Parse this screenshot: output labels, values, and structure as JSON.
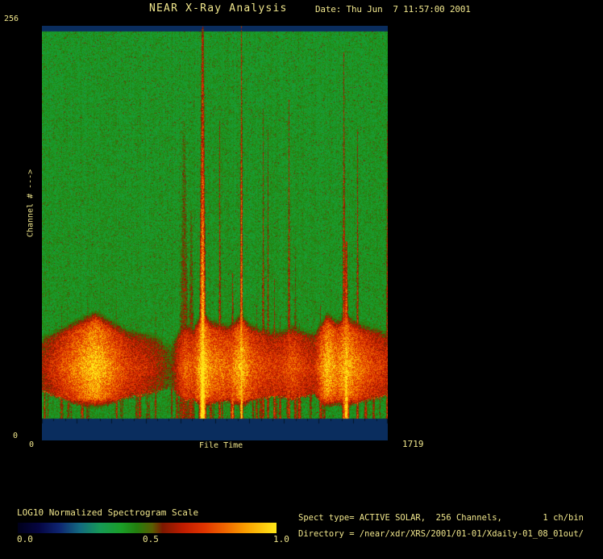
{
  "header": {
    "title": "NEAR X-Ray Analysis",
    "date": "Date: Thu Jun  7 11:57:00 2001"
  },
  "axes": {
    "y_max_label": "256",
    "y_min_label": "0",
    "y_axis_label": "Channel # --->",
    "x_min_label": "0",
    "x_axis_label": "File Time",
    "x_max_label": "1719"
  },
  "colorbar": {
    "label": "LOG10 Normalized Spectrogram Scale",
    "ticks": [
      "0.0",
      "0.5",
      "1.0"
    ]
  },
  "info": {
    "line1": "Spect type= ACTIVE SOLAR,  256 Channels,        1 ch/bin",
    "line2": "Directory = /near/xdr/XRS/2001/01-01/Xdaily-01_08_01out/"
  },
  "colors": {
    "text": "#f0e68c",
    "background": "#000000",
    "navy_band": "#0a2d5e"
  },
  "chart_data": {
    "type": "heatmap",
    "title": "NEAR X-Ray Analysis",
    "xlabel": "File Time",
    "ylabel": "Channel # --->",
    "x_range": [
      0,
      1719
    ],
    "y_range": [
      0,
      256
    ],
    "x_axis_ticks": [
      0,
      1719
    ],
    "y_axis_ticks": [
      0,
      256
    ],
    "colorbar": {
      "label": "LOG10 Normalized Spectrogram Scale",
      "range": [
        0.0,
        1.0
      ],
      "tick_values": [
        0.0,
        0.5,
        1.0
      ]
    },
    "palette_stops": [
      [
        0.0,
        "#00001a"
      ],
      [
        0.08,
        "#050541"
      ],
      [
        0.16,
        "#0e2470"
      ],
      [
        0.24,
        "#136a80"
      ],
      [
        0.32,
        "#169a55"
      ],
      [
        0.4,
        "#1a9e28"
      ],
      [
        0.46,
        "#237f0e"
      ],
      [
        0.52,
        "#585e02"
      ],
      [
        0.56,
        "#7c1800"
      ],
      [
        0.64,
        "#c01c00"
      ],
      [
        0.72,
        "#e03400"
      ],
      [
        0.8,
        "#ef6500"
      ],
      [
        0.88,
        "#fa9e00"
      ],
      [
        1.0,
        "#ffe818"
      ]
    ],
    "bands": {
      "top_channels": [
        252.5,
        256
      ],
      "bottom_channels": [
        0,
        13.5
      ],
      "color": "#0a2d5e"
    },
    "low_band": {
      "description": "bright low-channel emission band, log10 normalized intensity vs file time",
      "center_channel": 45,
      "profile": [
        [
          0,
          0.62
        ],
        [
          72,
          0.72
        ],
        [
          132,
          0.8
        ],
        [
          264,
          0.98
        ],
        [
          373,
          0.8
        ],
        [
          432,
          0.72
        ],
        [
          513,
          0.68
        ],
        [
          593,
          0.6
        ],
        [
          641,
          0.52
        ],
        [
          681,
          0.72
        ],
        [
          713,
          0.8
        ],
        [
          753,
          0.76
        ],
        [
          797,
          1.0
        ],
        [
          841,
          0.85
        ],
        [
          894,
          0.82
        ],
        [
          934,
          0.8
        ],
        [
          990,
          0.95
        ],
        [
          1034,
          0.8
        ],
        [
          1074,
          0.76
        ],
        [
          1134,
          0.72
        ],
        [
          1194,
          0.72
        ],
        [
          1246,
          0.78
        ],
        [
          1294,
          0.72
        ],
        [
          1354,
          0.68
        ],
        [
          1415,
          0.96
        ],
        [
          1467,
          0.85
        ],
        [
          1511,
          0.94
        ],
        [
          1555,
          0.85
        ],
        [
          1595,
          0.8
        ],
        [
          1643,
          0.75
        ],
        [
          1683,
          0.72
        ],
        [
          1719,
          0.68
        ]
      ]
    },
    "flares": [
      {
        "t": 797,
        "top_channel": 256,
        "w": 2.8,
        "amp": 0.8,
        "core": 0.32
      },
      {
        "t": 990,
        "top_channel": 256,
        "w": 1.3,
        "amp": 0.78,
        "core": 0.22
      },
      {
        "t": 882,
        "top_channel": 197,
        "w": 1.1,
        "amp": 0.7,
        "core": 0.0
      },
      {
        "t": 946,
        "top_channel": 103,
        "w": 1.4,
        "amp": 0.72,
        "core": 0.08
      },
      {
        "t": 705,
        "top_channel": 197,
        "w": 6.0,
        "amp": 0.6,
        "core": 0.0
      },
      {
        "t": 741,
        "top_channel": 142,
        "w": 3.5,
        "amp": 0.62,
        "core": 0.0
      },
      {
        "t": 563,
        "top_channel": 88,
        "w": 1.1,
        "amp": 0.62,
        "core": 0.0
      },
      {
        "t": 1098,
        "top_channel": 205,
        "w": 1.1,
        "amp": 0.68,
        "core": 0.0
      },
      {
        "t": 1122,
        "top_channel": 192,
        "w": 1.1,
        "amp": 0.66,
        "core": 0.0
      },
      {
        "t": 1154,
        "top_channel": 100,
        "w": 1.3,
        "amp": 0.68,
        "core": 0.0
      },
      {
        "t": 1182,
        "top_channel": 78,
        "w": 1.3,
        "amp": 0.63,
        "core": 0.0
      },
      {
        "t": 1226,
        "top_channel": 210,
        "w": 1.2,
        "amp": 0.7,
        "core": 0.0
      },
      {
        "t": 1258,
        "top_channel": 118,
        "w": 1.6,
        "amp": 0.62,
        "core": 0.0
      },
      {
        "t": 1499,
        "top_channel": 240,
        "w": 1.3,
        "amp": 0.72,
        "core": 0.06
      },
      {
        "t": 1511,
        "top_channel": 123,
        "w": 2.2,
        "amp": 0.85,
        "core": 0.15
      },
      {
        "t": 1567,
        "top_channel": 192,
        "w": 1.2,
        "amp": 0.7,
        "core": 0.0
      },
      {
        "t": 1607,
        "top_channel": 63,
        "w": 1.6,
        "amp": 0.62,
        "core": 0.0
      },
      {
        "t": 1647,
        "top_channel": 73,
        "w": 1.4,
        "amp": 0.6,
        "core": 0.0
      },
      {
        "t": 1715,
        "top_channel": 197,
        "w": 1.4,
        "amp": 0.66,
        "core": 0.0
      }
    ],
    "render": {
      "seed": 77,
      "spike_count": 42,
      "bg_base": 0.35,
      "bg_spread": 0.11,
      "speck_chance": 0.05,
      "tick_color": "#041629"
    }
  }
}
